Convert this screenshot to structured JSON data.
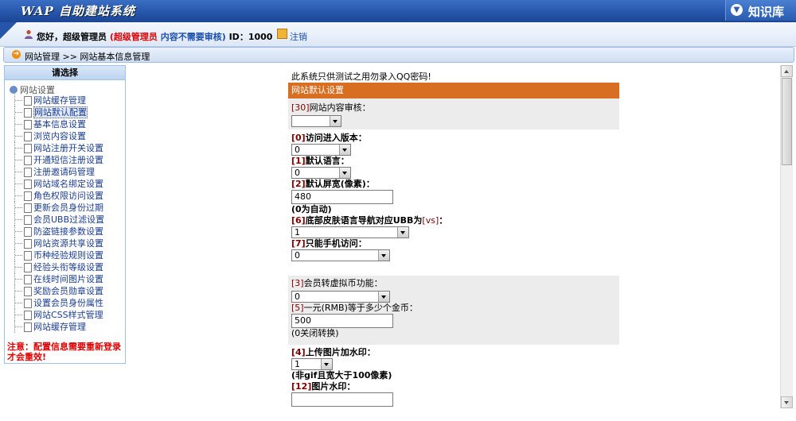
{
  "header": {
    "app_title": "WAP 自助建站系统",
    "kb_label": "知识库"
  },
  "userbar": {
    "greeting": "您好，超级管理员",
    "role_red": "(超级管理员",
    "role_blue": "内容不需要审核)",
    "id_text": "ID：1000",
    "logout": "注销"
  },
  "breadcrumb": "网站管理 >> 网站基本信息管理",
  "sidebar": {
    "header": "请选择",
    "root": "网站设置",
    "items": [
      {
        "label": "网站缓存管理"
      },
      {
        "label": "网站默认配置"
      },
      {
        "label": "基本信息设置"
      },
      {
        "label": "浏览内容设置"
      },
      {
        "label": "网站注册开关设置"
      },
      {
        "label": "开通短信注册设置"
      },
      {
        "label": "注册邀请码管理"
      },
      {
        "label": "网站域名绑定设置"
      },
      {
        "label": "角色权限访问设置"
      },
      {
        "label": "更新会员身份过期"
      },
      {
        "label": "会员UBB过滤设置"
      },
      {
        "label": "防盗链接参数设置"
      },
      {
        "label": "网站资源共享设置"
      },
      {
        "label": "币种经验规则设置"
      },
      {
        "label": "经验头衔等级设置"
      },
      {
        "label": "在线时间图片设置"
      },
      {
        "label": "奖励会员勋章设置"
      },
      {
        "label": "设置会员身份属性"
      },
      {
        "label": "网站CSS样式管理"
      },
      {
        "label": "网站缓存管理"
      }
    ],
    "notice": "注意：配置信息需要重新登录才会重效!"
  },
  "main": {
    "warning": "此系统只供测试之用勿录入QQ密码!",
    "section_title": "网站默认设置",
    "f30_idx": "[30]",
    "f30_label": "网站内容审核：",
    "f30_value": "",
    "f0_idx": "[0]",
    "f0_label": "访问进入版本：",
    "f0_value": "0",
    "f1_idx": "[1]",
    "f1_label": "默认语言：",
    "f1_value": "0",
    "f2_idx": "[2]",
    "f2_label": "默认屏宽(像素)：",
    "f2_value": "480",
    "f2_hint": "(0为自动)",
    "f6_idx": "[6]",
    "f6_label": "底部皮肤语言导航对应UBB为",
    "f6_tag": "[vs]",
    "f6_colon": "：",
    "f6_value": "1",
    "f7_idx": "[7]",
    "f7_label": "只能手机访问：",
    "f7_value": "0",
    "f3_idx": "[3]",
    "f3_label": "会员转虚拟币功能：",
    "f3_value": "0",
    "f5_idx": "[5]",
    "f5_label": "一元(RMB)等于多少个金币：",
    "f5_value": "500",
    "f5_hint": "(0关闭转换)",
    "f4_idx": "[4]",
    "f4_label": "上传图片加水印：",
    "f4_value": "1",
    "f4_hint": "(非gif且宽大于100像素)",
    "f12_idx": "[12]",
    "f12_label": "图片水印：",
    "f12_value": ""
  },
  "colors": {
    "header_blue": "#2554a8",
    "section_orange": "#d86e22",
    "notice_red": "#e00000",
    "link_blue": "#1a4fb0"
  }
}
